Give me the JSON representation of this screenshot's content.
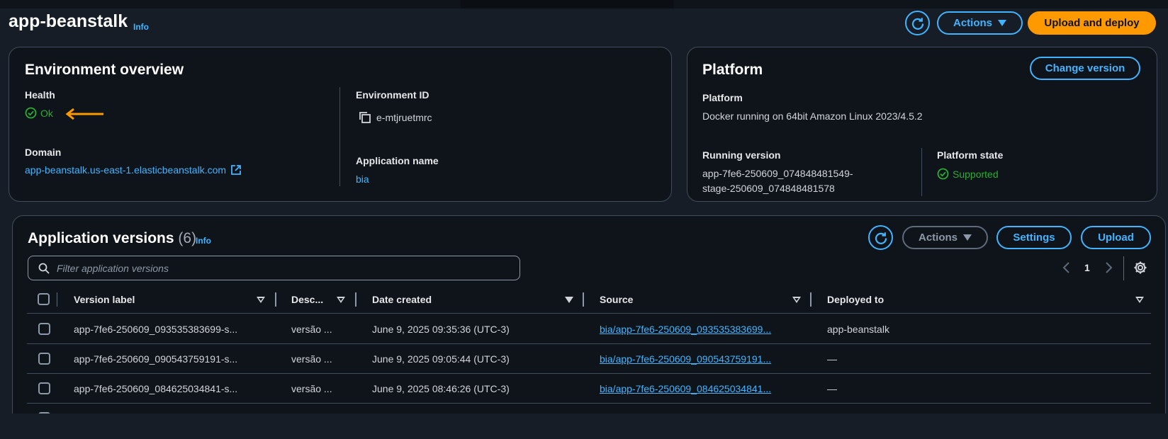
{
  "header": {
    "title": "app-beanstalk",
    "info_label": "Info",
    "actions_label": "Actions",
    "upload_deploy_label": "Upload and deploy"
  },
  "env_overview": {
    "title": "Environment overview",
    "health_label": "Health",
    "health_value": "Ok",
    "domain_label": "Domain",
    "domain_value": "app-beanstalk.us-east-1.elasticbeanstalk.com",
    "env_id_label": "Environment ID",
    "env_id_value": "e-mtjruetmrc",
    "app_name_label": "Application name",
    "app_name_value": "bia"
  },
  "platform": {
    "title": "Platform",
    "change_version_label": "Change version",
    "platform_label": "Platform",
    "platform_value": "Docker running on 64bit Amazon Linux 2023/4.5.2",
    "running_version_label": "Running version",
    "running_version_line1": "app-7fe6-250609_074848481549-",
    "running_version_line2": "stage-250609_074848481578",
    "state_label": "Platform state",
    "state_value": "Supported"
  },
  "versions": {
    "title": "Application versions",
    "count": "(6)",
    "info_label": "Info",
    "actions_label": "Actions",
    "settings_label": "Settings",
    "upload_label": "Upload",
    "search_placeholder": "Filter application versions",
    "page_number": "1",
    "columns": [
      "Version label",
      "Desc...",
      "Date created",
      "Source",
      "Deployed to"
    ],
    "rows": [
      {
        "label": "app-7fe6-250609_093535383699-s...",
        "desc": "versão ...",
        "date": "June 9, 2025 09:35:36 (UTC-3)",
        "source": "bia/app-7fe6-250609_093535383699...",
        "deployed": "app-beanstalk"
      },
      {
        "label": "app-7fe6-250609_090543759191-s...",
        "desc": "versão ...",
        "date": "June 9, 2025 09:05:44 (UTC-3)",
        "source": "bia/app-7fe6-250609_090543759191...",
        "deployed": "—"
      },
      {
        "label": "app-7fe6-250609_084625034841-s...",
        "desc": "versão ...",
        "date": "June 9, 2025 08:46:26 (UTC-3)",
        "source": "bia/app-7fe6-250609_084625034841...",
        "deployed": "—"
      }
    ]
  },
  "colors": {
    "accent": "#42b4ff",
    "primary": "#ff9900",
    "success": "#29ad32",
    "annotation": "#ff9900"
  }
}
